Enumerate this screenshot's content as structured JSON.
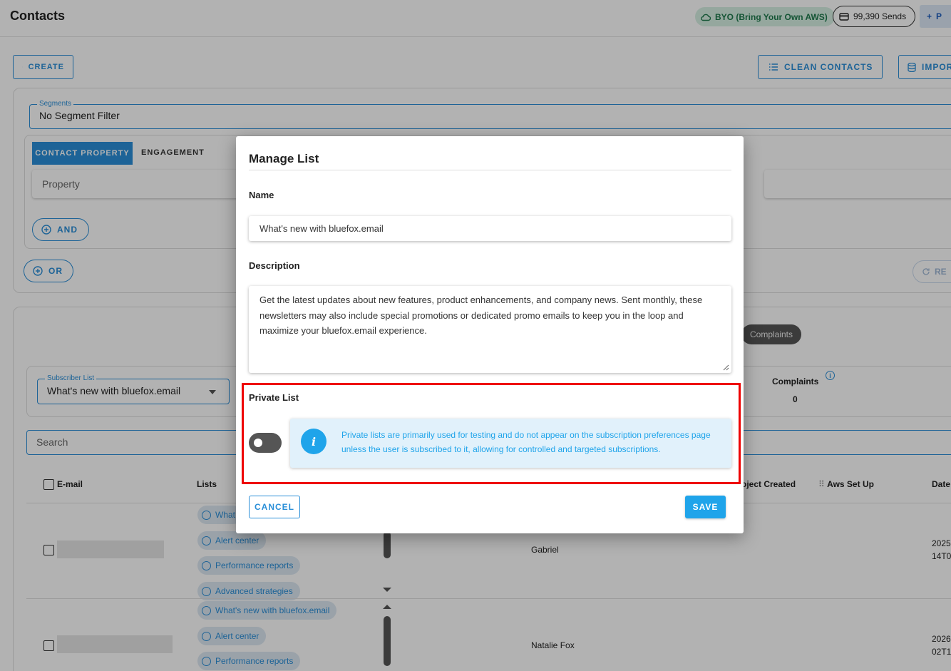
{
  "header": {
    "title": "Contacts",
    "byo_label": "BYO (Bring Your Own AWS)",
    "sends_label": "99,390 Sends",
    "plus_label": "P"
  },
  "toolbar": {
    "create_label": "CREATE",
    "clean_contacts_label": "CLEAN CONTACTS",
    "import_label": "IMPOR"
  },
  "filters": {
    "segments_legend": "Segments",
    "segments_value": "No Segment Filter",
    "tab_contact_property": "CONTACT PROPERTY",
    "tab_engagement": "ENGAGEMENT",
    "property_placeholder": "Property",
    "and_label": "AND",
    "or_label": "OR",
    "reset_label": "RE"
  },
  "lists_panel": {
    "complaints_chip": "Complaints",
    "subscriber_list_legend": "Subscriber List",
    "subscriber_list_value": "What's new with bluefox.email",
    "complaints_stat_label": "Complaints",
    "complaints_stat_value": "0",
    "search_placeholder": "Search"
  },
  "table": {
    "columns": {
      "email": "E-mail",
      "lists": "Lists",
      "project_created": "oject Created",
      "aws_set_up": "Aws Set Up",
      "date": "Date"
    },
    "rows": [
      {
        "chips": [
          "What",
          "Alert center",
          "Performance reports",
          "Advanced strategies"
        ],
        "name": "Gabriel",
        "date_line1": "2025",
        "date_line2": "14T0"
      },
      {
        "chips": [
          "What's new with bluefox.email",
          "Alert center",
          "Performance reports"
        ],
        "name": "Natalie Fox",
        "date_line1": "2026",
        "date_line2": "02T1"
      }
    ]
  },
  "dialog": {
    "title": "Manage List",
    "name_label": "Name",
    "name_value": "What's new with bluefox.email",
    "description_label": "Description",
    "description_value": "Get the latest updates about new features, product enhancements, and company news. Sent monthly, these newsletters may also include special promotions or dedicated promo emails to keep you in the loop and maximize your bluefox.email experience.",
    "private_label": "Private List",
    "private_enabled": false,
    "info_text": "Private lists are primarily used for testing and do not appear on the subscription preferences page unless the user is subscribed to it, allowing for controlled and targeted subscriptions.",
    "info_icon_glyph": "i",
    "cancel_label": "CANCEL",
    "save_label": "SAVE"
  },
  "colors": {
    "accent": "#2a8fd8",
    "info_blue": "#1fa4ea",
    "highlight_red": "#ee0000"
  }
}
